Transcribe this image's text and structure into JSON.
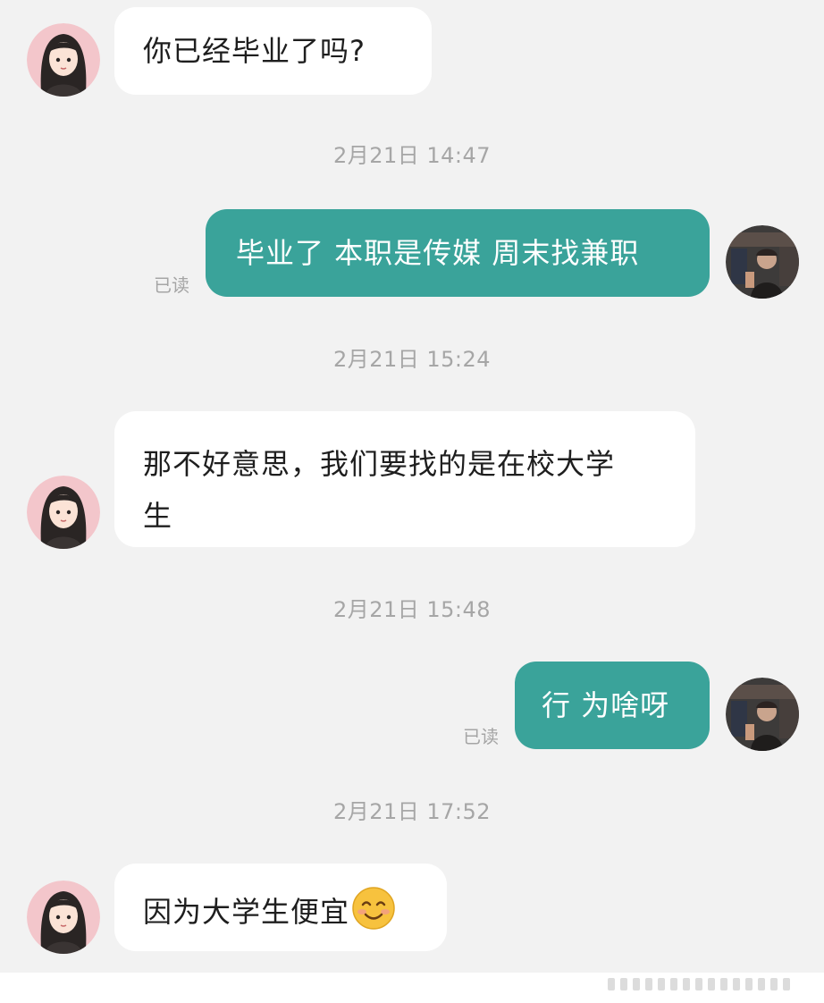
{
  "messages": [
    {
      "sender": "other",
      "text": "你已经毕业了吗?"
    },
    {
      "sender": "me",
      "text": "毕业了 本职是传媒 周末找兼职",
      "read_status": "已读"
    },
    {
      "sender": "other",
      "text_line1": "那不好意思，我们要找的是在校大学",
      "text_line2": "生"
    },
    {
      "sender": "me",
      "text": "行 为啥呀",
      "read_status": "已读"
    },
    {
      "sender": "other",
      "text": "因为大学生便宜",
      "emoji": "smiling-face-emoji"
    }
  ],
  "timestamps": [
    "2月21日 14:47",
    "2月21日 15:24",
    "2月21日 15:48",
    "2月21日 17:52"
  ],
  "colors": {
    "background": "#f2f2f2",
    "incoming_bubble": "#ffffff",
    "outgoing_bubble": "#3aa39a",
    "timestamp_text": "#a6a6a6"
  },
  "icons": {
    "other_avatar": "cartoon-girl-avatar",
    "my_avatar": "photo-avatar"
  }
}
